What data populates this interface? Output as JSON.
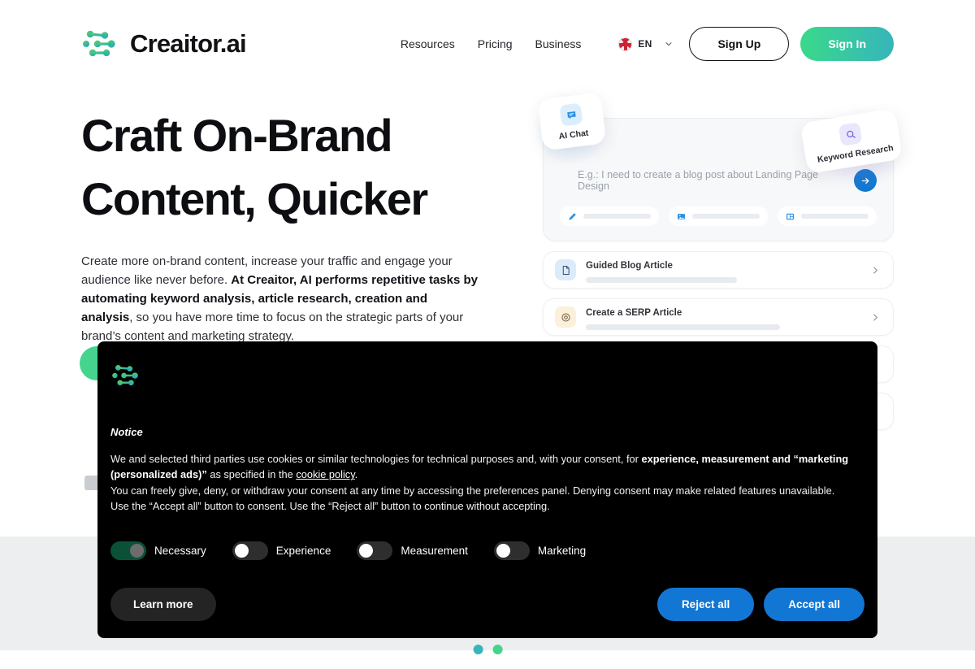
{
  "header": {
    "brand_name": "Creaitor.ai",
    "nav": [
      {
        "label": "Resources"
      },
      {
        "label": "Pricing"
      },
      {
        "label": "Business"
      }
    ],
    "language": {
      "label": "EN",
      "flag": "uk-flag-icon",
      "chevron": "chevron-down-icon"
    },
    "sign_up_label": "Sign Up",
    "sign_in_label": "Sign In",
    "accent_gradient_start": "#3ad98a",
    "accent_gradient_end": "#36b5bb"
  },
  "hero": {
    "title_line1": "Craft On-Brand",
    "title_line2": "Content, Quicker",
    "paragraph": {
      "part1": "Create more on-brand content, increase your traffic and engage your audience like never before. ",
      "bold": "At Creaitor, AI performs repetitive tasks by automating keyword analysis, article research, creation and analysis",
      "part2": ", so you have more time to focus on the strategic parts of your brand’s content and marketing strategy."
    }
  },
  "product_preview": {
    "float_cards": [
      {
        "label": "AI Chat",
        "icon": "chat-bubble-icon"
      },
      {
        "label": "Keyword Research",
        "icon": "search-icon"
      }
    ],
    "prompt_placeholder": "E.g.: I need to create a blog post about Landing Page Design",
    "send_icon": "arrow-right-icon",
    "chips": [
      {
        "icon": "pen-icon"
      },
      {
        "icon": "image-icon"
      },
      {
        "icon": "layout-icon"
      }
    ],
    "list_items": [
      {
        "title": "Guided Blog Article",
        "icon": "document-icon",
        "chevron": "chevron-right-icon"
      },
      {
        "title": "Create a SERP Article",
        "icon": "target-icon",
        "chevron": "chevron-right-icon"
      }
    ]
  },
  "cookie_banner": {
    "logo": "creaitor-logo-icon",
    "notice_label": "Notice",
    "paragraph1_part1": "We and selected third parties use cookies or similar technologies for technical purposes and, with your consent, for ",
    "paragraph1_bold1": "experience, measurement and “marketing (personalized ads)”",
    "paragraph1_part2": " as specified in the ",
    "cookie_policy_link": "cookie policy",
    "paragraph1_end": ".",
    "paragraph2": "You can freely give, deny, or withdraw your consent at any time by accessing the preferences panel. Denying consent may make related features unavailable.",
    "paragraph3": "Use the “Accept all” button to consent. Use the “Reject all” button to continue without accepting.",
    "toggles": [
      {
        "label": "Necessary",
        "state": "on"
      },
      {
        "label": "Experience",
        "state": "off"
      },
      {
        "label": "Measurement",
        "state": "off"
      },
      {
        "label": "Marketing",
        "state": "off"
      }
    ],
    "learn_more_label": "Learn more",
    "reject_all_label": "Reject all",
    "accept_all_label": "Accept all",
    "button_color": "#1277d4",
    "background_color": "#000000"
  }
}
